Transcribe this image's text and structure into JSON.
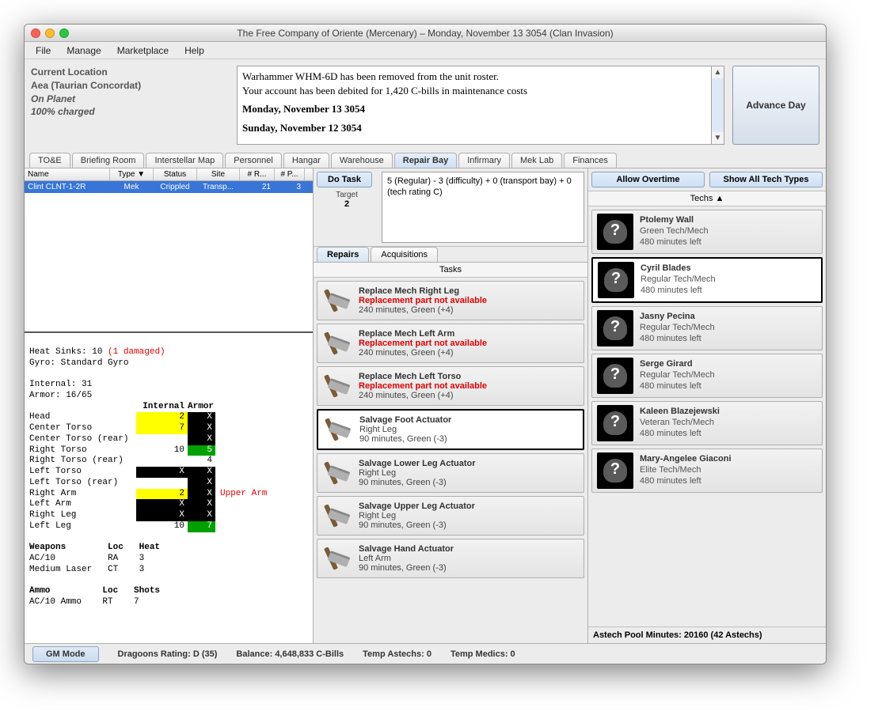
{
  "window": {
    "title": "The Free Company of Oriente (Mercenary) – Monday, November 13 3054 (Clan Invasion)"
  },
  "menu": {
    "items": [
      "File",
      "Manage",
      "Marketplace",
      "Help"
    ]
  },
  "location": {
    "label": "Current Location",
    "place": "Aea (Taurian Concordat)",
    "status": "On Planet",
    "charge": "100% charged"
  },
  "log": {
    "line1": "Warhammer WHM-6D has been removed from the unit roster.",
    "line2": "Your account has been debited for 1,420 C-bills in maintenance costs",
    "date1": "Monday, November 13 3054",
    "date2": "Sunday, November 12 3054"
  },
  "advance_day": "Advance Day",
  "main_tabs": [
    "TO&E",
    "Briefing Room",
    "Interstellar Map",
    "Personnel",
    "Hangar",
    "Warehouse",
    "Repair Bay",
    "Infirmary",
    "Mek Lab",
    "Finances"
  ],
  "main_tab_active": 6,
  "units": {
    "columns": [
      "Name",
      "Type ▼",
      "Status",
      "Site",
      "# R...",
      "# P..."
    ],
    "row": {
      "name": "Clint CLNT-1-2R",
      "type": "Mek",
      "status": "Crippled",
      "site": "Transp...",
      "r": "21",
      "p": "3"
    }
  },
  "detail": {
    "heat_sinks_label": "Heat Sinks: 10 ",
    "heat_sinks_dmg": "(1 damaged)",
    "gyro": "Gyro: Standard Gyro",
    "internal": "Internal: 31",
    "armor": "Armor: 16/65",
    "armor_header": {
      "loc": "",
      "int": "Internal",
      "arm": "Armor"
    },
    "rows": [
      {
        "loc": "Head",
        "int": "2",
        "arm": "X",
        "int_cls": "cell-yellow",
        "arm_cls": "cell-black",
        "note": ""
      },
      {
        "loc": "Center Torso",
        "int": "7",
        "arm": "X",
        "int_cls": "cell-yellow",
        "arm_cls": "cell-black",
        "note": ""
      },
      {
        "loc": "Center Torso (rear)",
        "int": "",
        "arm": "X",
        "int_cls": "",
        "arm_cls": "cell-black",
        "note": ""
      },
      {
        "loc": "Right Torso",
        "int": "10",
        "arm": "5",
        "int_cls": "",
        "arm_cls": "cell-green",
        "note": ""
      },
      {
        "loc": "Right Torso (rear)",
        "int": "",
        "arm": "4",
        "int_cls": "",
        "arm_cls": "",
        "note": ""
      },
      {
        "loc": "Left Torso",
        "int": "X",
        "arm": "X",
        "int_cls": "cell-black",
        "arm_cls": "cell-black",
        "note": ""
      },
      {
        "loc": "Left Torso (rear)",
        "int": "",
        "arm": "X",
        "int_cls": "",
        "arm_cls": "cell-black",
        "note": ""
      },
      {
        "loc": "Right Arm",
        "int": "2",
        "arm": "X",
        "int_cls": "cell-yellow",
        "arm_cls": "cell-black",
        "note": "Upper Arm",
        "note_cls": "red"
      },
      {
        "loc": "Left Arm",
        "int": "X",
        "arm": "X",
        "int_cls": "cell-black",
        "arm_cls": "cell-black",
        "note": ""
      },
      {
        "loc": "Right Leg",
        "int": "X",
        "arm": "X",
        "int_cls": "cell-black",
        "arm_cls": "cell-black",
        "note": ""
      },
      {
        "loc": "Left Leg",
        "int": "10",
        "arm": "7",
        "int_cls": "",
        "arm_cls": "cell-green",
        "note": ""
      }
    ],
    "weapons_header": "Weapons        Loc   Heat",
    "weapons": [
      "AC/10          RA    3",
      "Medium Laser   CT    3"
    ],
    "ammo_header": "Ammo          Loc   Shots",
    "ammo": [
      "AC/10 Ammo    RT    7"
    ]
  },
  "do_task": {
    "btn": "Do Task",
    "target_label": "Target",
    "target_value": "2"
  },
  "task_status": "5 (Regular) - 3 (difficulty) + 0 (transport bay) + 0 (tech rating C)",
  "mid_tabs": [
    "Repairs",
    "Acquisitions"
  ],
  "mid_tab_active": 0,
  "tasks_title": "Tasks",
  "tasks": [
    {
      "title": "Replace Mech Right Leg",
      "warn": "Replacement part not available",
      "meta": "240 minutes, Green (+4)",
      "selected": false
    },
    {
      "title": "Replace Mech Left Arm",
      "warn": "Replacement part not available",
      "meta": "240 minutes, Green (+4)",
      "selected": false
    },
    {
      "title": "Replace Mech Left Torso",
      "warn": "Replacement part not available",
      "meta": "240 minutes, Green (+4)",
      "selected": false
    },
    {
      "title": "Salvage Foot Actuator",
      "warn": "Right Leg",
      "meta": "90 minutes, Green (-3)",
      "selected": true,
      "warn_red": false
    },
    {
      "title": "Salvage Lower Leg Actuator",
      "warn": "Right Leg",
      "meta": "90 minutes, Green (-3)",
      "selected": false,
      "warn_red": false
    },
    {
      "title": "Salvage Upper Leg Actuator",
      "warn": "Right Leg",
      "meta": "90 minutes, Green (-3)",
      "selected": false,
      "warn_red": false
    },
    {
      "title": "Salvage Hand Actuator",
      "warn": "Left Arm",
      "meta": "90 minutes, Green (-3)",
      "selected": false,
      "warn_red": false
    }
  ],
  "right_buttons": {
    "overtime": "Allow Overtime",
    "showall": "Show All Tech Types"
  },
  "techs_title": "Techs ▲",
  "techs": [
    {
      "name": "Ptolemy Wall",
      "skill": "Green Tech/Mech",
      "left": "480 minutes left",
      "selected": false
    },
    {
      "name": "Cyril Blades",
      "skill": "Regular Tech/Mech",
      "left": "480 minutes left",
      "selected": true
    },
    {
      "name": "Jasny Pecina",
      "skill": "Regular Tech/Mech",
      "left": "480 minutes left",
      "selected": false
    },
    {
      "name": "Serge Girard",
      "skill": "Regular Tech/Mech",
      "left": "480 minutes left",
      "selected": false
    },
    {
      "name": "Kaleen Blazejewski",
      "skill": "Veteran Tech/Mech",
      "left": "480 minutes left",
      "selected": false
    },
    {
      "name": "Mary-Angelee Giaconi",
      "skill": "Elite Tech/Mech",
      "left": "480 minutes left",
      "selected": false
    }
  ],
  "pool": "Astech Pool Minutes: 20160 (42 Astechs)",
  "statusbar": {
    "gm": "GM Mode",
    "dragoons": "Dragoons Rating: D (35)",
    "balance": "Balance: 4,648,833 C-Bills",
    "astechs": "Temp Astechs: 0",
    "medics": "Temp Medics: 0"
  }
}
